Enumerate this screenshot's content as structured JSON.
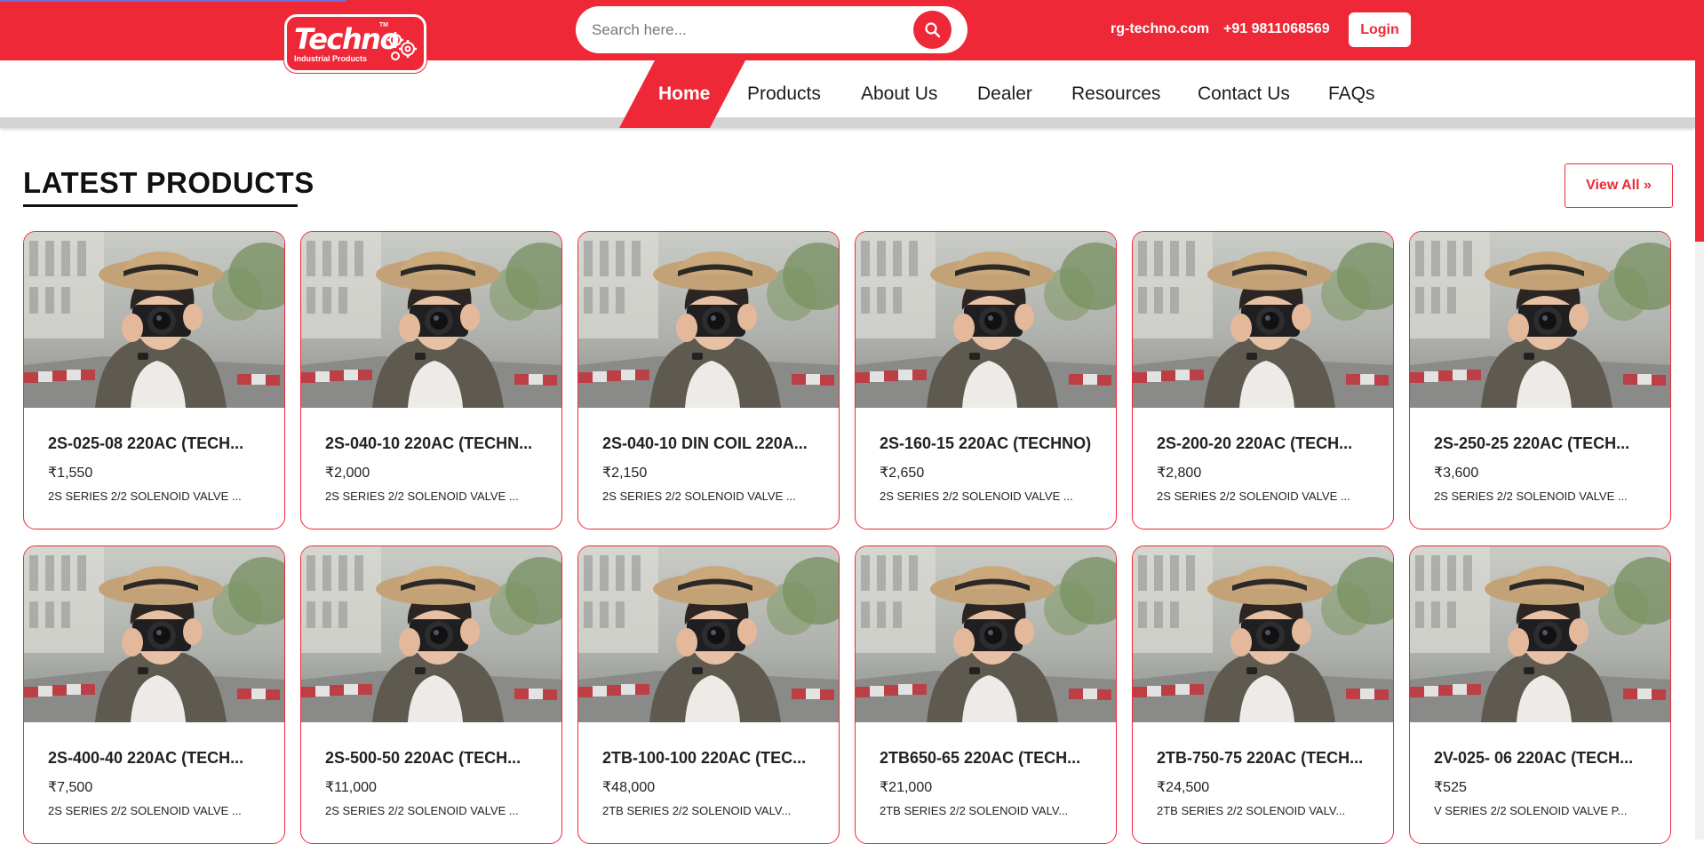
{
  "header": {
    "logo": {
      "brand": "Techno",
      "tagline": "Industrial Products",
      "tm": "TM"
    },
    "search": {
      "placeholder": "Search here..."
    },
    "website": "rg-techno.com",
    "phone": "+91 9811068569",
    "login_label": "Login"
  },
  "nav": {
    "items": [
      "Home",
      "Products",
      "About Us",
      "Dealer",
      "Resources",
      "Contact Us",
      "FAQs"
    ],
    "active": "Home"
  },
  "section": {
    "title": "LATEST PRODUCTS",
    "view_all_label": "View All »"
  },
  "products": [
    {
      "name": "2S-025-08 220AC (TECH...",
      "price": "₹1,550",
      "desc": "2S SERIES 2/2 SOLENOID VALVE ..."
    },
    {
      "name": "2S-040-10 220AC (TECHN...",
      "price": "₹2,000",
      "desc": "2S SERIES 2/2 SOLENOID VALVE ..."
    },
    {
      "name": "2S-040-10 DIN COIL 220A...",
      "price": "₹2,150",
      "desc": "2S SERIES 2/2 SOLENOID VALVE ..."
    },
    {
      "name": "2S-160-15 220AC (TECHNO)",
      "price": "₹2,650",
      "desc": "2S SERIES 2/2 SOLENOID VALVE ..."
    },
    {
      "name": "2S-200-20 220AC (TECH...",
      "price": "₹2,800",
      "desc": "2S SERIES 2/2 SOLENOID VALVE ..."
    },
    {
      "name": "2S-250-25 220AC (TECH...",
      "price": "₹3,600",
      "desc": "2S SERIES 2/2 SOLENOID VALVE ..."
    },
    {
      "name": "2S-400-40 220AC (TECH...",
      "price": "₹7,500",
      "desc": "2S SERIES 2/2 SOLENOID VALVE ..."
    },
    {
      "name": "2S-500-50 220AC (TECH...",
      "price": "₹11,000",
      "desc": "2S SERIES 2/2 SOLENOID VALVE ..."
    },
    {
      "name": "2TB-100-100 220AC (TEC...",
      "price": "₹48,000",
      "desc": "2TB SERIES 2/2 SOLENOID VALV..."
    },
    {
      "name": "2TB650-65 220AC (TECH...",
      "price": "₹21,000",
      "desc": "2TB SERIES 2/2 SOLENOID VALV..."
    },
    {
      "name": "2TB-750-75 220AC (TECH...",
      "price": "₹24,500",
      "desc": "2TB SERIES 2/2 SOLENOID VALV..."
    },
    {
      "name": "2V-025- 06 220AC (TECH...",
      "price": "₹525",
      "desc": "V SERIES 2/2 SOLENOID VALVE P..."
    }
  ],
  "icons": {
    "search": "search-icon",
    "product_photo": "photographer-image"
  },
  "colors": {
    "brand_red": "#ee2837",
    "nav_border": "#d6d3d6"
  }
}
